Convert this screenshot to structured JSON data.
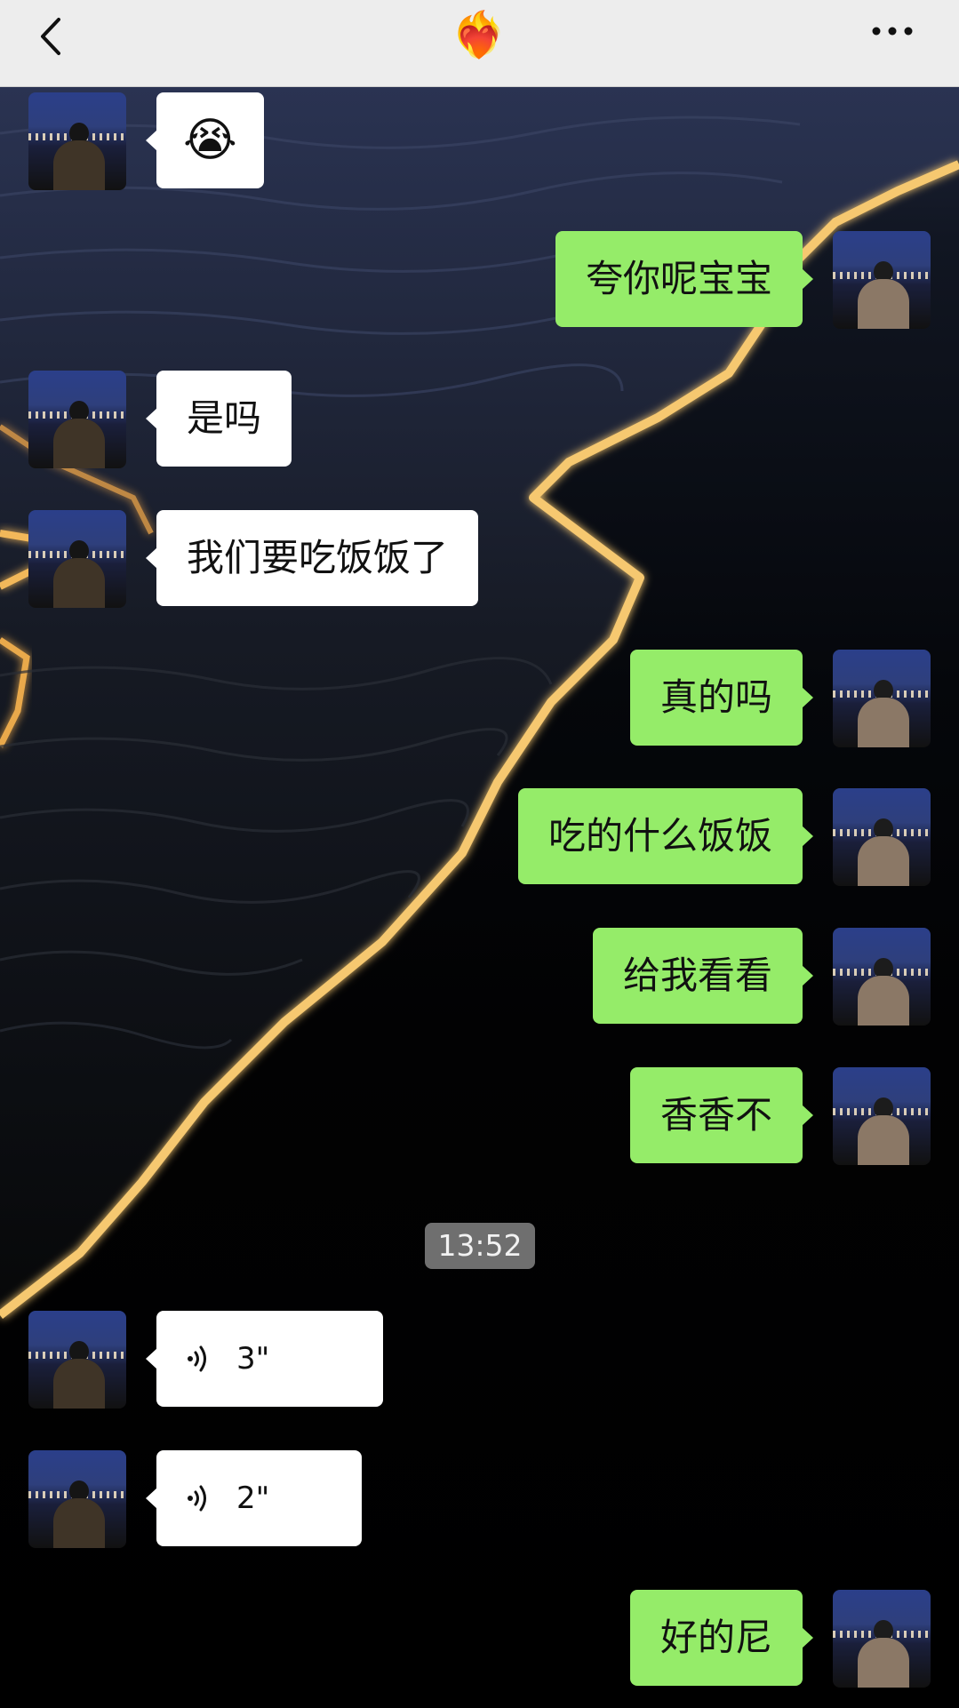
{
  "header": {
    "title_emoji": "❤️‍🔥"
  },
  "messages": [
    {
      "side": "in",
      "type": "emoji",
      "text": "😭"
    },
    {
      "side": "out",
      "type": "text",
      "text": "夸你呢宝宝"
    },
    {
      "side": "in",
      "type": "text",
      "text": "是吗"
    },
    {
      "side": "in",
      "type": "text",
      "text": "我们要吃饭饭了"
    },
    {
      "side": "out",
      "type": "text",
      "text": "真的吗"
    },
    {
      "side": "out",
      "type": "text",
      "text": "吃的什么饭饭"
    },
    {
      "side": "out",
      "type": "text",
      "text": "给我看看"
    },
    {
      "side": "out",
      "type": "text",
      "text": "香香不"
    },
    {
      "side": "in",
      "type": "voice",
      "duration": "3\""
    },
    {
      "side": "in",
      "type": "voice",
      "duration": "2\""
    },
    {
      "side": "out",
      "type": "text",
      "text": "好的尼"
    }
  ],
  "timestamp": "13:52"
}
